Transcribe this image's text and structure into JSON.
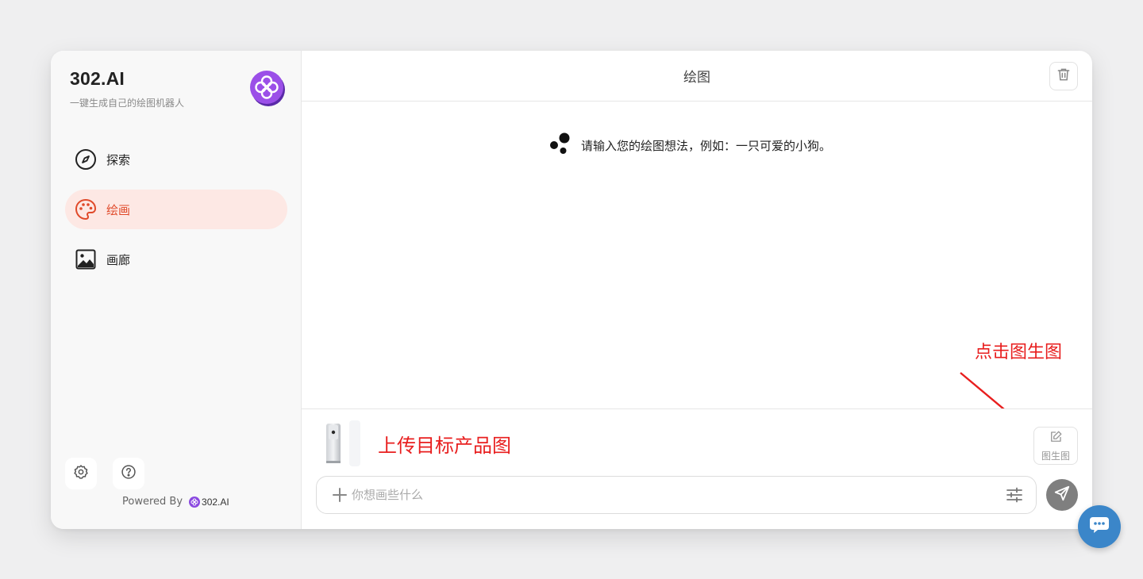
{
  "sidebar": {
    "brand_title": "302.AI",
    "brand_subtitle": "一键生成自己的绘图机器人",
    "items": [
      {
        "label": "探索",
        "icon": "compass-icon"
      },
      {
        "label": "绘画",
        "icon": "palette-icon",
        "active": true
      },
      {
        "label": "画廊",
        "icon": "gallery-image-icon"
      }
    ],
    "powered_by": "Powered By",
    "powered_brand": "302.AI"
  },
  "header": {
    "title": "绘图"
  },
  "chat": {
    "prompt_message": "请输入您的绘图想法，例如：一只可爱的小狗。"
  },
  "annotations": {
    "click_img2img": "点击图生图",
    "upload_product": "上传目标产品图"
  },
  "composer": {
    "img2img_label": "图生图",
    "input_placeholder": "你想画些什么",
    "input_value": ""
  },
  "colors": {
    "accent": "#e04a2a",
    "active_bg": "#fde8e4",
    "brand_purple": "#8b4ae0",
    "annotation_red": "#e81e1e",
    "send_button": "#7f7f7f",
    "chat_fab": "#3b86c9"
  }
}
